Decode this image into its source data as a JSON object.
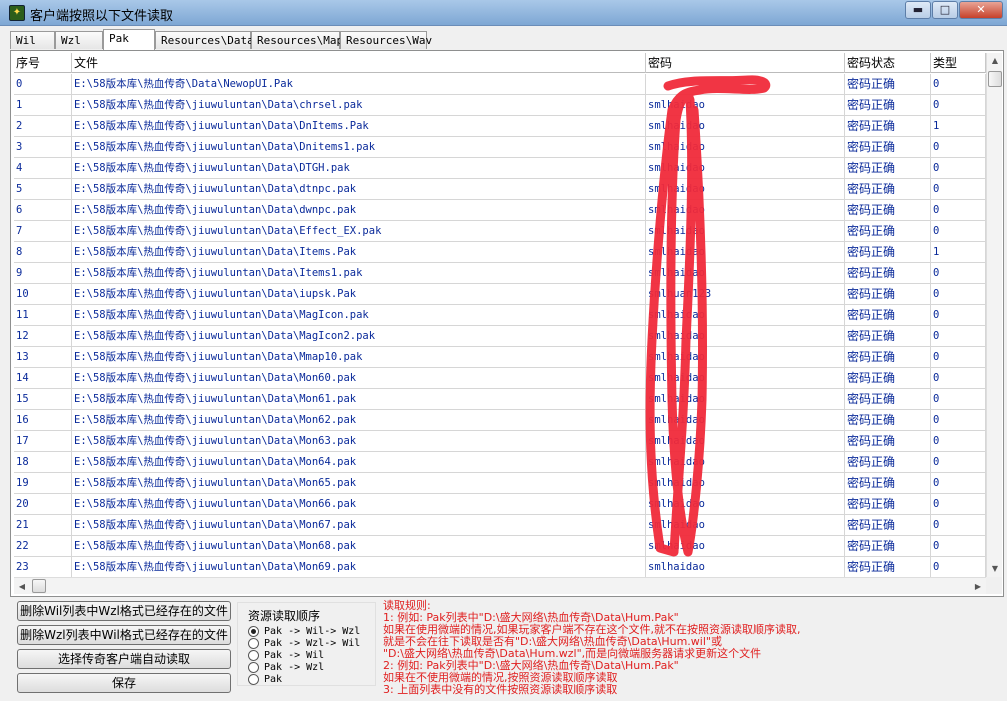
{
  "window": {
    "title": "客户端按照以下文件读取",
    "minimize": "▬",
    "maximize": "□",
    "close": "✕",
    "icon": "app-icon"
  },
  "tabs": [
    {
      "label": "Wil",
      "active": false
    },
    {
      "label": "Wzl",
      "active": false
    },
    {
      "label": "Pak",
      "active": true
    },
    {
      "label": "Resources\\Data",
      "active": false
    },
    {
      "label": "Resources\\Map",
      "active": false
    },
    {
      "label": "Resources\\Wav",
      "active": false
    }
  ],
  "table": {
    "columns": [
      "序号",
      "文件",
      "密码",
      "密码状态",
      "类型"
    ],
    "rows": [
      {
        "index": "0",
        "file": "E:\\58版本库\\热血传奇\\Data\\NewopUI.Pak",
        "password": "",
        "status": "密码正确",
        "type": "0"
      },
      {
        "index": "1",
        "file": "E:\\58版本库\\热血传奇\\jiuwuluntan\\Data\\chrsel.pak",
        "password": "smlhaidao",
        "status": "密码正确",
        "type": "0"
      },
      {
        "index": "2",
        "file": "E:\\58版本库\\热血传奇\\jiuwuluntan\\Data\\DnItems.Pak",
        "password": "smlhaidao",
        "status": "密码正确",
        "type": "1"
      },
      {
        "index": "3",
        "file": "E:\\58版本库\\热血传奇\\jiuwuluntan\\Data\\Dnitems1.pak",
        "password": "smlhaidao",
        "status": "密码正确",
        "type": "0"
      },
      {
        "index": "4",
        "file": "E:\\58版本库\\热血传奇\\jiuwuluntan\\Data\\DTGH.pak",
        "password": "smlhaidao",
        "status": "密码正确",
        "type": "0"
      },
      {
        "index": "5",
        "file": "E:\\58版本库\\热血传奇\\jiuwuluntan\\Data\\dtnpc.pak",
        "password": "smlhaidao",
        "status": "密码正确",
        "type": "0"
      },
      {
        "index": "6",
        "file": "E:\\58版本库\\热血传奇\\jiuwuluntan\\Data\\dwnpc.pak",
        "password": "smlhaidao",
        "status": "密码正确",
        "type": "0"
      },
      {
        "index": "7",
        "file": "E:\\58版本库\\热血传奇\\jiuwuluntan\\Data\\Effect_EX.pak",
        "password": "smlhaidao",
        "status": "密码正确",
        "type": "0"
      },
      {
        "index": "8",
        "file": "E:\\58版本库\\热血传奇\\jiuwuluntan\\Data\\Items.Pak",
        "password": "smlhaidao",
        "status": "密码正确",
        "type": "1"
      },
      {
        "index": "9",
        "file": "E:\\58版本库\\热血传奇\\jiuwuluntan\\Data\\Items1.pak",
        "password": "smlhaidao",
        "status": "密码正确",
        "type": "0"
      },
      {
        "index": "10",
        "file": "E:\\58版本库\\热血传奇\\jiuwuluntan\\Data\\iupsk.Pak",
        "password": "smlhuan123",
        "status": "密码正确",
        "type": "0"
      },
      {
        "index": "11",
        "file": "E:\\58版本库\\热血传奇\\jiuwuluntan\\Data\\MagIcon.pak",
        "password": "smlhaidao",
        "status": "密码正确",
        "type": "0"
      },
      {
        "index": "12",
        "file": "E:\\58版本库\\热血传奇\\jiuwuluntan\\Data\\MagIcon2.pak",
        "password": "smlhaidao",
        "status": "密码正确",
        "type": "0"
      },
      {
        "index": "13",
        "file": "E:\\58版本库\\热血传奇\\jiuwuluntan\\Data\\Mmap10.pak",
        "password": "smlhaidao",
        "status": "密码正确",
        "type": "0"
      },
      {
        "index": "14",
        "file": "E:\\58版本库\\热血传奇\\jiuwuluntan\\Data\\Mon60.pak",
        "password": "smlhaidao",
        "status": "密码正确",
        "type": "0"
      },
      {
        "index": "15",
        "file": "E:\\58版本库\\热血传奇\\jiuwuluntan\\Data\\Mon61.pak",
        "password": "smlhaidao",
        "status": "密码正确",
        "type": "0"
      },
      {
        "index": "16",
        "file": "E:\\58版本库\\热血传奇\\jiuwuluntan\\Data\\Mon62.pak",
        "password": "smlhaidao",
        "status": "密码正确",
        "type": "0"
      },
      {
        "index": "17",
        "file": "E:\\58版本库\\热血传奇\\jiuwuluntan\\Data\\Mon63.pak",
        "password": "smlhaidao",
        "status": "密码正确",
        "type": "0"
      },
      {
        "index": "18",
        "file": "E:\\58版本库\\热血传奇\\jiuwuluntan\\Data\\Mon64.pak",
        "password": "smlhaidao",
        "status": "密码正确",
        "type": "0"
      },
      {
        "index": "19",
        "file": "E:\\58版本库\\热血传奇\\jiuwuluntan\\Data\\Mon65.pak",
        "password": "smlhaidao",
        "status": "密码正确",
        "type": "0"
      },
      {
        "index": "20",
        "file": "E:\\58版本库\\热血传奇\\jiuwuluntan\\Data\\Mon66.pak",
        "password": "smlhaidao",
        "status": "密码正确",
        "type": "0"
      },
      {
        "index": "21",
        "file": "E:\\58版本库\\热血传奇\\jiuwuluntan\\Data\\Mon67.pak",
        "password": "smlhaidao",
        "status": "密码正确",
        "type": "0"
      },
      {
        "index": "22",
        "file": "E:\\58版本库\\热血传奇\\jiuwuluntan\\Data\\Mon68.pak",
        "password": "smlhaidao",
        "status": "密码正确",
        "type": "0"
      },
      {
        "index": "23",
        "file": "E:\\58版本库\\热血传奇\\jiuwuluntan\\Data\\Mon69.pak",
        "password": "smlhaidao",
        "status": "密码正确",
        "type": "0"
      }
    ]
  },
  "buttons": {
    "delete_wil": "删除Wil列表中Wzl格式已经存在的文件",
    "delete_wzl": "删除Wzl列表中Wil格式已经存在的文件",
    "select_client": "选择传奇客户端自动读取",
    "save": "保存"
  },
  "read_order": {
    "title": "资源读取顺序",
    "options": [
      {
        "label": "Pak -> Wil-> Wzl",
        "selected": true
      },
      {
        "label": "Pak -> Wzl-> Wil",
        "selected": false
      },
      {
        "label": "Pak -> Wil",
        "selected": false
      },
      {
        "label": "Pak -> Wzl",
        "selected": false
      },
      {
        "label": "Pak",
        "selected": false
      }
    ]
  },
  "rules": {
    "heading": "读取规则:",
    "lines": [
      "1: 例如: Pak列表中\"D:\\盛大网络\\热血传奇\\Data\\Hum.Pak\"",
      "    如果在使用微端的情况,如果玩家客户端不存在这个文件,就不在按照资源读取顺序读取,",
      "    就是不会在往下读取是否有\"D:\\盛大网络\\热血传奇\\Data\\Hum.wil\"或",
      "    \"D:\\盛大网络\\热血传奇\\Data\\Hum.wzl\",而是向微端服务器请求更新这个文件",
      "2: 例如: Pak列表中\"D:\\盛大网络\\热血传奇\\Data\\Hum.Pak\"",
      "    如果在不使用微端的情况,按照资源读取顺序读取",
      "3: 上面列表中没有的文件按照资源读取顺序读取"
    ]
  },
  "colors": {
    "cell_text": "#0a2a9a",
    "rules_text": "#e02020",
    "scribble": "#f02a3a"
  }
}
